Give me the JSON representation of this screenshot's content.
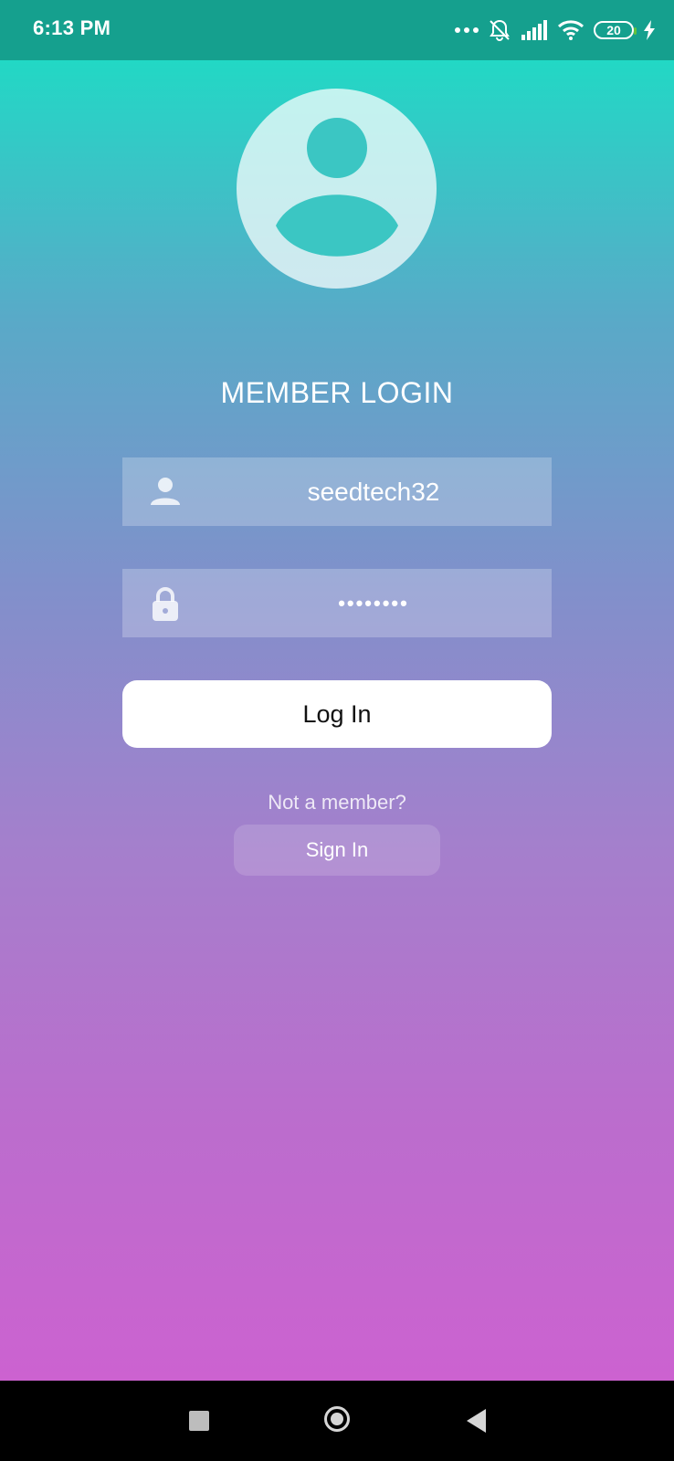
{
  "status_bar": {
    "time": "6:13 PM",
    "battery_level": "20",
    "icons": [
      "more-dots-icon",
      "bell-off-icon",
      "signal-icon",
      "wifi-icon",
      "battery-icon",
      "charging-bolt-icon"
    ]
  },
  "login": {
    "title": "MEMBER LOGIN",
    "username_value": "seedtech32",
    "password_value": "••••••••",
    "login_button": "Log In",
    "not_member_text": "Not a member?",
    "signin_button": "Sign In"
  },
  "colors": {
    "status_bar_bg": "#15a08e",
    "gradient_top": "#22d8c5",
    "gradient_bottom": "#cc62d0",
    "button_bg": "#ffffff"
  },
  "nav_bar": {
    "buttons": [
      "recents-icon",
      "home-icon",
      "back-icon"
    ]
  }
}
